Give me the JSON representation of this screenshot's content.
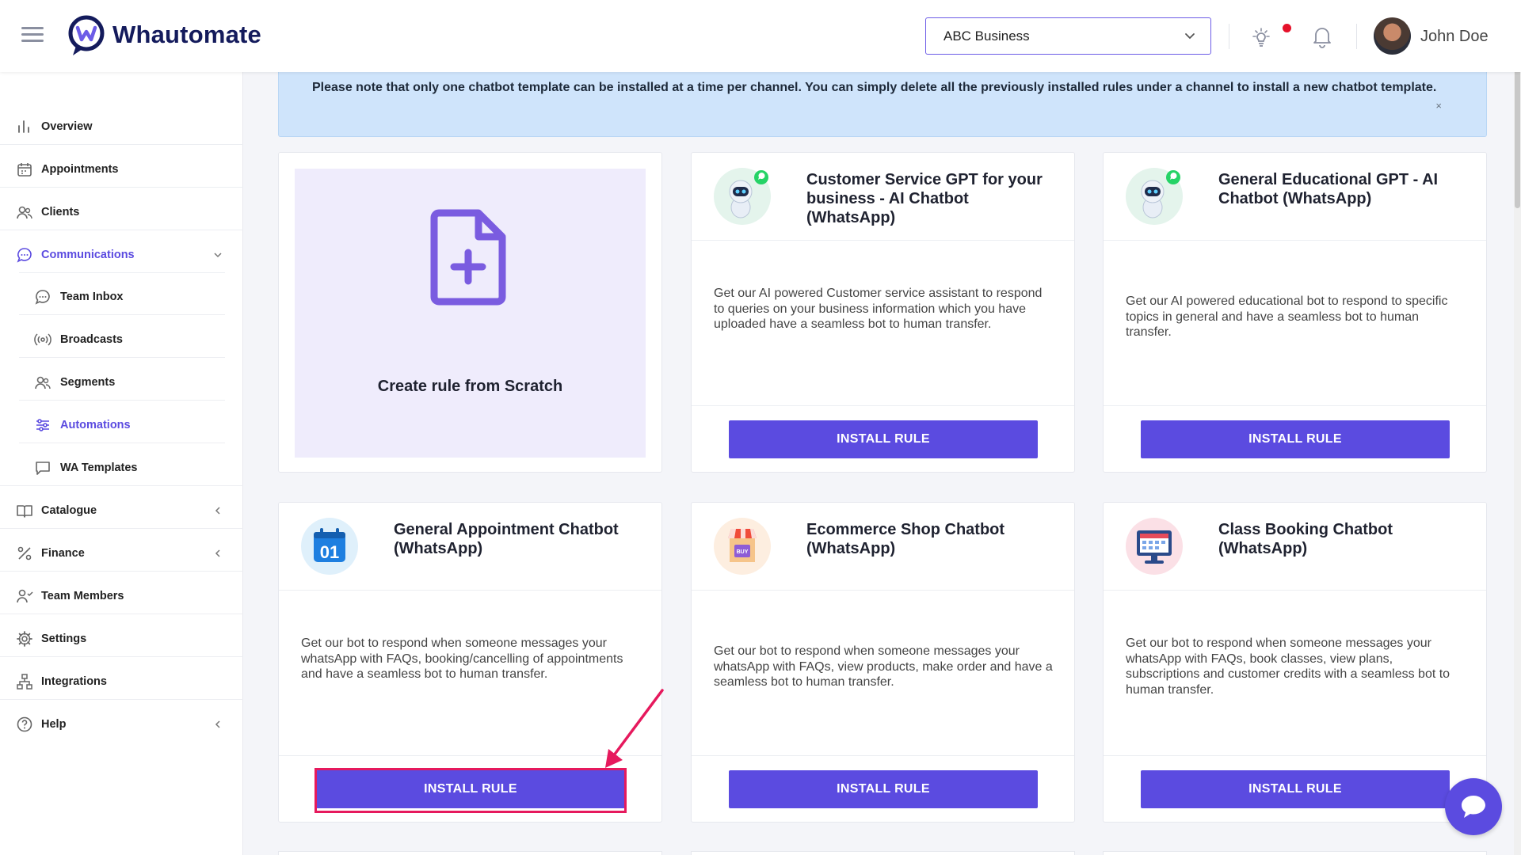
{
  "header": {
    "logo_text": "Whautomate",
    "business_select": "ABC Business",
    "user_name": "John Doe"
  },
  "sidebar": {
    "items": [
      {
        "label": "Overview",
        "icon": "bar-chart-icon"
      },
      {
        "label": "Appointments",
        "icon": "calendar-icon"
      },
      {
        "label": "Clients",
        "icon": "users-icon"
      },
      {
        "label": "Communications",
        "icon": "chat-bubble-icon"
      },
      {
        "label": "Team Inbox",
        "icon": "chat-bubble-icon"
      },
      {
        "label": "Broadcasts",
        "icon": "broadcast-icon"
      },
      {
        "label": "Segments",
        "icon": "users-icon"
      },
      {
        "label": "Automations",
        "icon": "sliders-icon"
      },
      {
        "label": "WA Templates",
        "icon": "message-square-icon"
      },
      {
        "label": "Catalogue",
        "icon": "book-icon"
      },
      {
        "label": "Finance",
        "icon": "percent-icon"
      },
      {
        "label": "Team Members",
        "icon": "team-icon"
      },
      {
        "label": "Settings",
        "icon": "gear-icon"
      },
      {
        "label": "Integrations",
        "icon": "network-icon"
      },
      {
        "label": "Help",
        "icon": "help-icon"
      }
    ]
  },
  "notice": {
    "text": "Please note that only one chatbot template can be installed at a time per channel. You can simply delete all the previously installed rules under a channel to install a new chatbot template.",
    "close": "×"
  },
  "scratch": {
    "title": "Create rule from Scratch"
  },
  "cards": [
    {
      "title": "Customer Service GPT for your business - AI Chatbot (WhatsApp)",
      "desc": "Get our AI powered Customer service assistant to respond to queries on your business information which you have uploaded have a seamless bot to human transfer.",
      "button": "INSTALL RULE",
      "icon": "robot-icon"
    },
    {
      "title": "General Educational GPT - AI Chatbot (WhatsApp)",
      "desc": "Get our AI powered educational bot to respond to specific topics in general and have a seamless bot to human transfer.",
      "button": "INSTALL RULE",
      "icon": "robot-icon"
    },
    {
      "title": "General Appointment Chatbot (WhatsApp)",
      "desc": "Get our bot to respond when someone messages your whatsApp with FAQs, booking/cancelling of appointments and have a seamless bot to human transfer.",
      "button": "INSTALL RULE",
      "icon": "calendar-01-icon",
      "icon_text": "01"
    },
    {
      "title": "Ecommerce Shop Chatbot (WhatsApp)",
      "desc": "Get our bot to respond when someone messages your whatsApp with FAQs, view products, make order and have a seamless bot to human transfer.",
      "button": "INSTALL RULE",
      "icon": "shop-icon",
      "icon_text": "BUY"
    },
    {
      "title": "Class Booking Chatbot (WhatsApp)",
      "desc": "Get our bot to respond when someone messages your whatsApp with FAQs, book classes, view plans, subscriptions and customer credits with a seamless bot to human transfer.",
      "button": "INSTALL RULE",
      "icon": "monitor-calendar-icon"
    }
  ],
  "colors": {
    "accent": "#5b4be0",
    "highlight": "#e6195d",
    "notice_bg": "#cfe4fb"
  }
}
